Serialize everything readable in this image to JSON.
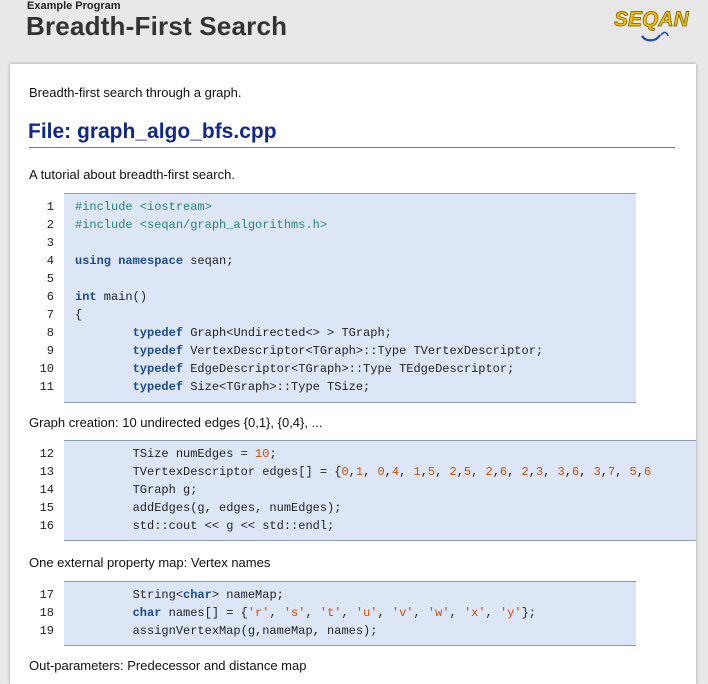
{
  "header": {
    "kicker": "Example Program",
    "title": "Breadth-First Search",
    "logo_text": "SEQAN"
  },
  "intro": "Breadth-first search through a graph.",
  "file_heading": "File: graph_algo_bfs.cpp",
  "tutorial_text": "A tutorial about breadth-first search.",
  "block1": {
    "numbers": [
      "1",
      "2",
      "3",
      "4",
      "5",
      "6",
      "7",
      "8",
      "9",
      "10",
      "11"
    ],
    "lines": [
      "#include <iostream>",
      "#include <seqan/graph_algorithms.h>",
      "",
      "using namespace seqan;",
      "",
      "int main()",
      "{",
      "        typedef Graph<Undirected<> > TGraph;",
      "        typedef VertexDescriptor<TGraph>::Type TVertexDescriptor;",
      "        typedef EdgeDescriptor<TGraph>::Type TEdgeDescriptor;",
      "        typedef Size<TGraph>::Type TSize;"
    ]
  },
  "graph_creation_text": "Graph creation: 10 undirected edges {0,1}, {0,4}, ...",
  "block2": {
    "numbers": [
      "12",
      "13",
      "14",
      "15",
      "16"
    ],
    "lines": [
      "        TSize numEdges = 10;",
      "        TVertexDescriptor edges[] = {0,1, 0,4, 1,5, 2,5, 2,6, 2,3, 3,6, 3,7, 5,6",
      "        TGraph g;",
      "        addEdges(g, edges, numEdges);",
      "        std::cout << g << std::endl;"
    ]
  },
  "property_map_text": "One external property map: Vertex names",
  "block3": {
    "numbers": [
      "17",
      "18",
      "19"
    ],
    "lines": [
      "        String<char> nameMap;",
      "        char names[] = {'r', 's', 't', 'u', 'v', 'w', 'x', 'y'};",
      "        assignVertexMap(g,nameMap, names);"
    ]
  },
  "out_params_text": "Out-parameters: Predecessor and distance map",
  "colors": {
    "keyword": "#1a4b8c",
    "preprocessor": "#26837a",
    "literal": "#cc4f00",
    "code_bg": "#dde6f7",
    "heading": "#10278c"
  }
}
